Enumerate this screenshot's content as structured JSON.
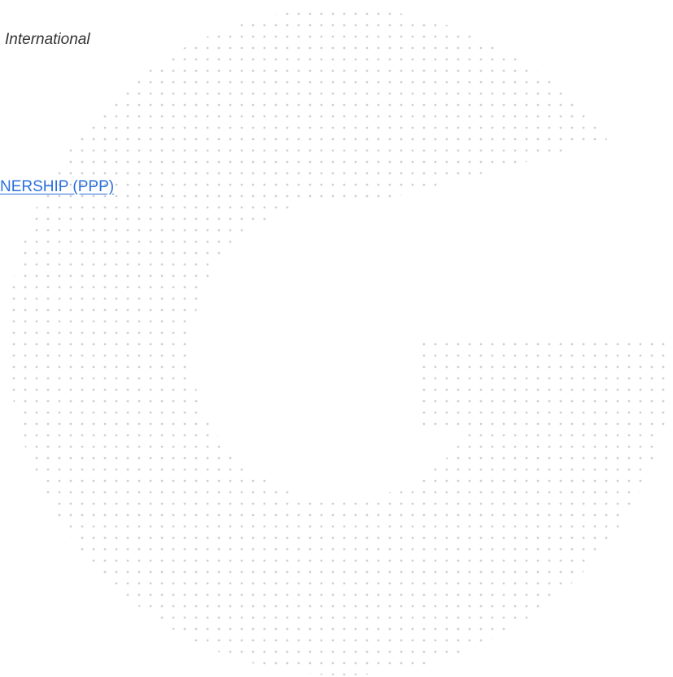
{
  "page": {
    "subtitle": "International",
    "link_text": "NERSHIP (PPP)"
  },
  "colors": {
    "link": "#2a6fdb",
    "text": "#333333",
    "dots": "#cfcfcf"
  },
  "icons": {
    "background_logo": "dotted-g-logo"
  }
}
